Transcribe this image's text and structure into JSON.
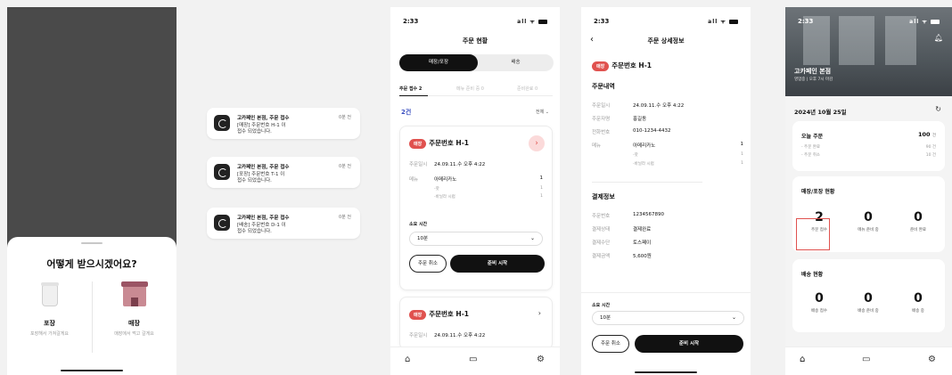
{
  "sheet": {
    "question": "어떻게 받으시겠어요?",
    "options": [
      {
        "title": "포장",
        "subtitle": "포장해서 가져갈게요",
        "icon": "cup-icon"
      },
      {
        "title": "매장",
        "subtitle": "매장에서 먹고 갈게요",
        "icon": "store-icon"
      }
    ]
  },
  "notifications": [
    {
      "title": "고카페인 본점, 주문 접수",
      "ago": "0분 전",
      "line1": "[매장] 주문번호 H-1 이",
      "line2": "접수 되었습니다."
    },
    {
      "title": "고카페인 본점, 주문 접수",
      "ago": "0분 전",
      "line1": "[포장] 주문번호 T-1 이",
      "line2": "접수 되었습니다."
    },
    {
      "title": "고카페인 본점, 주문 접수",
      "ago": "0분 전",
      "line1": "[배송] 주문번호 D-1 이",
      "line2": "접수 되었습니다."
    }
  ],
  "status": {
    "time": "2:33",
    "signal": "all ᯤ"
  },
  "orders": {
    "title": "주문 현황",
    "segment": {
      "on": "매장/포장",
      "off": "배송"
    },
    "tabs": [
      "주문 접수 2",
      "메뉴 준비 중 0",
      "준비완료 0"
    ],
    "count": "2건",
    "filter": "전체 ⌄",
    "card1": {
      "badge": "매장",
      "order_no": "주문번호 H-1",
      "date_key": "주문일시",
      "date_val": "24.09.11.수 오후 4:22",
      "menu_key": "메뉴",
      "menu_val": "아메리카노",
      "menu_qty": "1",
      "opt1": "-핫",
      "opt1_qty": "1",
      "opt2": "-바닐라 시럽",
      "opt2_qty": "1",
      "time_label": "소요 시간",
      "time_val": "10분",
      "cancel": "주문 취소",
      "start": "준비 시작"
    },
    "card2": {
      "badge": "매장",
      "order_no": "주문번호 H-1",
      "date_key": "주문일시",
      "date_val": "24.09.11.수 오후 4:22"
    }
  },
  "detail": {
    "title": "주문 상세정보",
    "badge": "매장",
    "order_no": "주문번호 H-1",
    "section1": "주문내역",
    "rows1": [
      {
        "k": "주문일시",
        "v": "24.09.11.수 오후 4:22"
      },
      {
        "k": "주문자명",
        "v": "홍길동"
      },
      {
        "k": "전화번호",
        "v": "010-1234-4432"
      },
      {
        "k": "메뉴",
        "v": "아메리카노"
      }
    ],
    "menu_qty": "1",
    "opt1": "-핫",
    "opt1_qty": "1",
    "opt2": "-바닐라 시럽",
    "opt2_qty": "1",
    "section2": "결제정보",
    "rows2": [
      {
        "k": "주문번호",
        "v": "1234567890"
      },
      {
        "k": "결제상태",
        "v": "결제완료"
      },
      {
        "k": "결제수단",
        "v": "토스페이"
      },
      {
        "k": "결제금액",
        "v": "5,600원"
      }
    ],
    "time_label": "소요 시간",
    "time_val": "10분",
    "cancel": "주문 취소",
    "start": "준비 시작"
  },
  "dashboard": {
    "store": "고카페인 본점",
    "hours": "영업중 | 오후 7시 마감",
    "date": "2024년 10월 25일",
    "today": {
      "title": "오늘 주문",
      "value": "100",
      "unit": "건",
      "r1k": "- 주문 완료",
      "r1v": "90 건",
      "r2k": "- 주문 취소",
      "r2v": "10 건"
    },
    "store_status": {
      "title": "매장/포장 현황",
      "stats": [
        {
          "n": "2",
          "l": "주문 접수"
        },
        {
          "n": "0",
          "l": "메뉴 준비 중"
        },
        {
          "n": "0",
          "l": "준비 완료"
        }
      ]
    },
    "delivery_status": {
      "title": "배송 현황",
      "stats": [
        {
          "n": "0",
          "l": "배송 접수"
        },
        {
          "n": "0",
          "l": "배송 준비 중"
        },
        {
          "n": "0",
          "l": "배송 중"
        }
      ]
    }
  },
  "tabbar_icons": [
    "home-icon",
    "monitor-icon",
    "gear-icon"
  ],
  "colors": {
    "accent": "#e0524f",
    "count": "#3a4fc0",
    "dark": "#111111"
  }
}
